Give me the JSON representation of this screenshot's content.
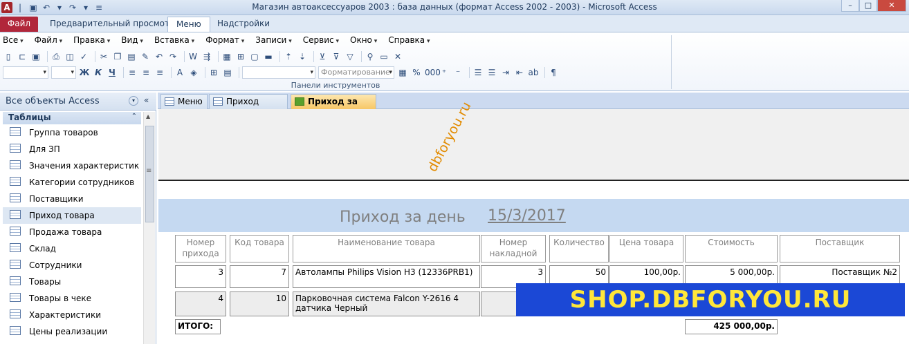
{
  "window": {
    "title": "Магазин автоаксессуаров 2003 : база данных (формат Access 2002 - 2003)  -  Microsoft Access"
  },
  "ribbon_tabs": [
    {
      "label": "Файл"
    },
    {
      "label": "Предварительный просмотр"
    },
    {
      "label": "Меню"
    },
    {
      "label": "Надстройки"
    }
  ],
  "menu_items": [
    "Все",
    "Файл",
    "Правка",
    "Вид",
    "Вставка",
    "Формат",
    "Записи",
    "Сервис",
    "Окно",
    "Справка"
  ],
  "toolbar": {
    "format_combo_placeholder": "Форматирование",
    "bold_label": "Ж",
    "italic_label": "К",
    "underline_label": "Ч",
    "group_label": "Панели инструментов"
  },
  "nav": {
    "header": "Все объекты Access",
    "group": "Таблицы",
    "items": [
      "Группа товаров",
      "Для ЗП",
      "Значения характеристик",
      "Категории сотрудников",
      "Поставщики",
      "Приход товара",
      "Продажа товара",
      "Склад",
      "Сотрудники",
      "Товары",
      "Товары в чеке",
      "Характеристики",
      "Цены реализации"
    ],
    "selected_index": 5
  },
  "doc_tabs": [
    {
      "label": "Меню"
    },
    {
      "label": "Приход товара"
    },
    {
      "label": "Приход за день"
    }
  ],
  "watermark": "dbforyou.ru",
  "report": {
    "title": "Приход за день",
    "date": "15/3/2017",
    "columns": [
      "Номер прихода",
      "Код товара",
      "Наименование товара",
      "Номер накладной",
      "Количество",
      "Цена товара",
      "Стоимость",
      "Поставщик"
    ],
    "rows": [
      {
        "num": "3",
        "code": "7",
        "name": "Автолампы Philips Vision H3 (12336PRB1)",
        "invoice": "3",
        "qty": "50",
        "price": "100,00р.",
        "cost": "5 000,00р.",
        "supplier": "Поставщик №2"
      },
      {
        "num": "4",
        "code": "10",
        "name": "Парковочная система Falcon Y-2616 4 датчика Черный",
        "invoice": "",
        "qty": "",
        "price": "",
        "cost": "",
        "supplier": ""
      }
    ],
    "total_label": "ИТОГО:",
    "total_value": "425 000,00р."
  },
  "banner": "SHOP.DBFORYOU.RU"
}
